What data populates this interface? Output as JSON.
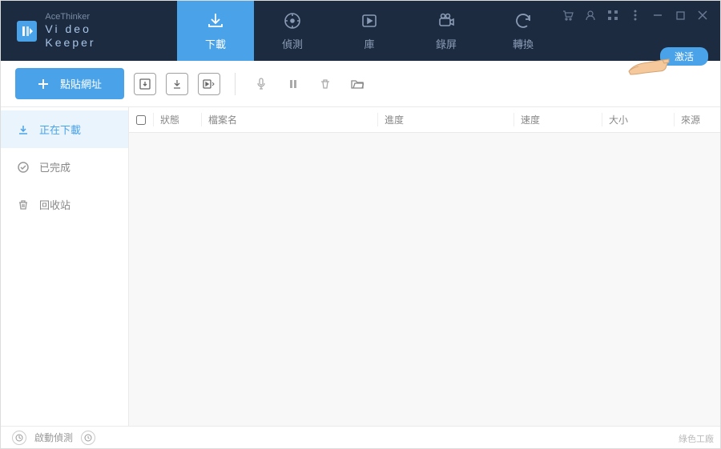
{
  "app": {
    "brand": "AceThinker",
    "name": "Vi deo  Keeper"
  },
  "nav": {
    "tabs": [
      {
        "label": "下載",
        "icon": "download",
        "active": true
      },
      {
        "label": "偵測",
        "icon": "detect"
      },
      {
        "label": "庫",
        "icon": "library"
      },
      {
        "label": "錄屏",
        "icon": "record"
      },
      {
        "label": "轉換",
        "icon": "convert"
      }
    ]
  },
  "activate": {
    "label": "激活"
  },
  "toolbar": {
    "paste_label": "點貼網址"
  },
  "sidebar": {
    "items": [
      {
        "label": "正在下載",
        "icon": "downloading",
        "active": true
      },
      {
        "label": "已完成",
        "icon": "completed"
      },
      {
        "label": "回收站",
        "icon": "trash"
      }
    ]
  },
  "table": {
    "columns": {
      "checkbox": "",
      "status": "狀態",
      "name": "檔案名",
      "progress": "進度",
      "speed": "速度",
      "size": "大小",
      "source": "來源"
    },
    "rows": []
  },
  "footer": {
    "auto_detect": "啟動偵測"
  },
  "watermark": "綠色工廠"
}
